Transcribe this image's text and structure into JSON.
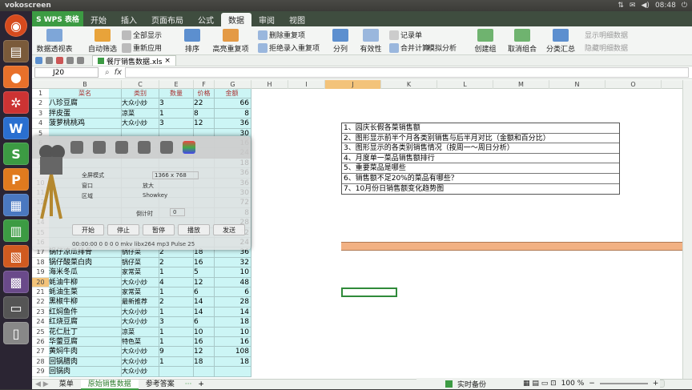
{
  "system": {
    "app_name": "vokoscreen",
    "time": "08:48"
  },
  "ribbon": {
    "wps_label": "S WPS 表格",
    "tabs": [
      {
        "label": "开始"
      },
      {
        "label": "插入"
      },
      {
        "label": "页面布局"
      },
      {
        "label": "公式"
      },
      {
        "label": "数据"
      },
      {
        "label": "审阅"
      },
      {
        "label": "视图"
      }
    ],
    "active_tab": "数据",
    "pivot": "数据透视表",
    "autofilter": "自动筛选",
    "show_all": "全部显示",
    "reapply": "重新应用",
    "sort": "排序",
    "highlight_dup": "高亮重复项",
    "delete_dup": "删除重复项",
    "reject_dup": "拒绝录入重复项",
    "split": "分列",
    "validity": "有效性",
    "record": "记录单",
    "consolidate": "合并计算",
    "simulate": "模拟分析",
    "create_group": "创建组",
    "ungroup": "取消组合",
    "subtotal": "分类汇总",
    "show_detail": "显示明细数据",
    "hide_detail": "隐藏明细数据"
  },
  "file_tab": {
    "name": "餐厅销售数据.xls"
  },
  "formula_bar": {
    "cell_ref": "J20",
    "fx": "fx"
  },
  "columns": [
    "A",
    "B",
    "C",
    "D",
    "E",
    "F",
    "G",
    "H",
    "I",
    "J",
    "K",
    "L",
    "M",
    "N",
    "O"
  ],
  "selected_column": "J",
  "rows": [
    {
      "n": "1",
      "b": "菜名",
      "c": "类别",
      "e": "数量",
      "f": "价格",
      "g": "金额"
    },
    {
      "n": "2",
      "b": "八珍豆腐",
      "c": "大众小炒",
      "e": "3",
      "f": "22",
      "g": "66"
    },
    {
      "n": "3",
      "b": "拌皮蛋",
      "c": "凉菜",
      "e": "1",
      "f": "8",
      "g": "8"
    },
    {
      "n": "4",
      "b": "菠萝桃桃鸡",
      "c": "大众小炒",
      "e": "3",
      "f": "12",
      "g": "36"
    },
    {
      "n": "5",
      "b": "",
      "c": "",
      "e": "",
      "f": "",
      "g": "30"
    },
    {
      "n": "6",
      "b": "",
      "c": "",
      "e": "",
      "f": "",
      "g": "16"
    },
    {
      "n": "7",
      "b": "",
      "c": "",
      "e": "",
      "f": "",
      "g": "24"
    },
    {
      "n": "8",
      "b": "",
      "c": "",
      "e": "",
      "f": "",
      "g": "18"
    },
    {
      "n": "9",
      "b": "",
      "c": "",
      "e": "",
      "f": "",
      "g": "36"
    },
    {
      "n": "10",
      "b": "",
      "c": "",
      "e": "",
      "f": "",
      "g": "36"
    },
    {
      "n": "11",
      "b": "",
      "c": "",
      "e": "",
      "f": "",
      "g": "30"
    },
    {
      "n": "12",
      "b": "",
      "c": "",
      "e": "",
      "f": "",
      "g": "72"
    },
    {
      "n": "13",
      "b": "",
      "c": "",
      "e": "",
      "f": "",
      "g": "8"
    },
    {
      "n": "14",
      "b": "",
      "c": "",
      "e": "",
      "f": "",
      "g": "28"
    },
    {
      "n": "15",
      "b": "",
      "c": "",
      "e": "",
      "f": "",
      "g": "72"
    },
    {
      "n": "16",
      "b": "",
      "c": "",
      "e": "",
      "f": "",
      "g": "24"
    },
    {
      "n": "17",
      "b": "锅仔凉瓜排骨",
      "c": "锅仔菜",
      "e": "2",
      "f": "18",
      "g": "36"
    },
    {
      "n": "18",
      "b": "锅仔酸菜白肉",
      "c": "锅仔菜",
      "e": "2",
      "f": "16",
      "g": "32"
    },
    {
      "n": "19",
      "b": "海米冬瓜",
      "c": "家常菜",
      "e": "1",
      "f": "5",
      "g": "10"
    },
    {
      "n": "20",
      "b": "蚝油牛柳",
      "c": "大众小炒",
      "e": "4",
      "f": "12",
      "g": "48"
    },
    {
      "n": "21",
      "b": "蚝油生菜",
      "c": "家常菜",
      "e": "1",
      "f": "6",
      "g": "6"
    },
    {
      "n": "22",
      "b": "黑椒牛柳",
      "c": "最新推荐",
      "e": "2",
      "f": "14",
      "g": "28"
    },
    {
      "n": "23",
      "b": "红焖鱼件",
      "c": "大众小炒",
      "e": "1",
      "f": "14",
      "g": "14"
    },
    {
      "n": "24",
      "b": "红烧豆腐",
      "c": "大众小炒",
      "e": "3",
      "f": "6",
      "g": "18"
    },
    {
      "n": "25",
      "b": "花仁肚丁",
      "c": "凉菜",
      "e": "1",
      "f": "10",
      "g": "10"
    },
    {
      "n": "26",
      "b": "华蓥豆腐",
      "c": "特色菜",
      "e": "1",
      "f": "16",
      "g": "16"
    },
    {
      "n": "27",
      "b": "黄焖牛肉",
      "c": "大众小炒",
      "e": "9",
      "f": "12",
      "g": "108"
    },
    {
      "n": "28",
      "b": "回锅腊肉",
      "c": "大众小炒",
      "e": "1",
      "f": "18",
      "g": "18"
    },
    {
      "n": "29",
      "b": "回锅肉",
      "c": "大众小炒",
      "e": "",
      "f": "",
      "g": ""
    }
  ],
  "tasks": [
    "1、园庆长假各菜销售额",
    "2、图形显示前半个月各类别销售与后半月对比（金额和百分比）",
    "3、图形显示的各类别销售情况（按周一～周日分析）",
    "4、月度单一菜品销售额排行",
    "5、重要菜品是哪些",
    "6、销售额不足20%的菜品有哪些？",
    "7、10月份日销售额变化趋势图"
  ],
  "recorder": {
    "options": [
      "全屏模式",
      "窗口",
      "区域"
    ],
    "size": "1366 x 768",
    "opt2": "放大",
    "opt3": "Showkey",
    "countdown": "倒计时",
    "count_val": "0",
    "buttons": [
      "开始",
      "停止",
      "暂停",
      "播放",
      "发送"
    ],
    "status": "00:00:00   0   0   0   0   mkv   libx264   mp3   Pulse   25"
  },
  "sheets": [
    {
      "label": "菜单"
    },
    {
      "label": "原始销售数据"
    },
    {
      "label": "参考答案"
    }
  ],
  "active_sheet": "原始销售数据",
  "sheet_more": "···",
  "sheet_add": "+",
  "status": {
    "backup": "实时备份",
    "zoom": "100 %"
  }
}
